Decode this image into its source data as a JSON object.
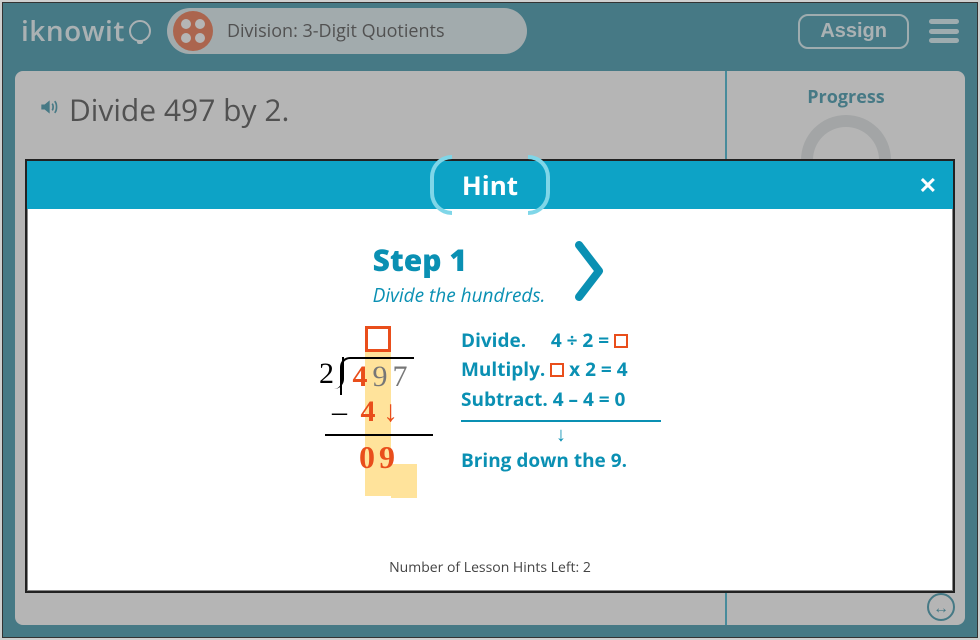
{
  "header": {
    "logo_text": "iknowit",
    "lesson_title": "Division: 3-Digit Quotients",
    "assign_label": "Assign"
  },
  "question": {
    "text": "Divide 497 by 2."
  },
  "progress": {
    "label": "Progress"
  },
  "hint": {
    "title": "Hint",
    "step_label": "Step 1",
    "step_subtitle": "Divide the hundreds.",
    "divisor": "2",
    "dividend_digits": [
      "4",
      "9",
      "7"
    ],
    "subtract_value": "4",
    "result_digits": "09",
    "explain_divide_label": "Divide.",
    "explain_divide_expr": "4 ÷ 2 =",
    "explain_multiply_label": "Multiply.",
    "explain_multiply_expr": "x 2 = 4",
    "explain_subtract_label": "Subtract.",
    "explain_subtract_expr": "4 – 4 = 0",
    "bring_down": "Bring down the 9.",
    "footer": "Number of Lesson Hints Left: 2"
  },
  "colors": {
    "brand": "#0a7a95",
    "accent": "#0da3c6",
    "orange": "#e94e1b",
    "highlight": "#ffe39b"
  }
}
